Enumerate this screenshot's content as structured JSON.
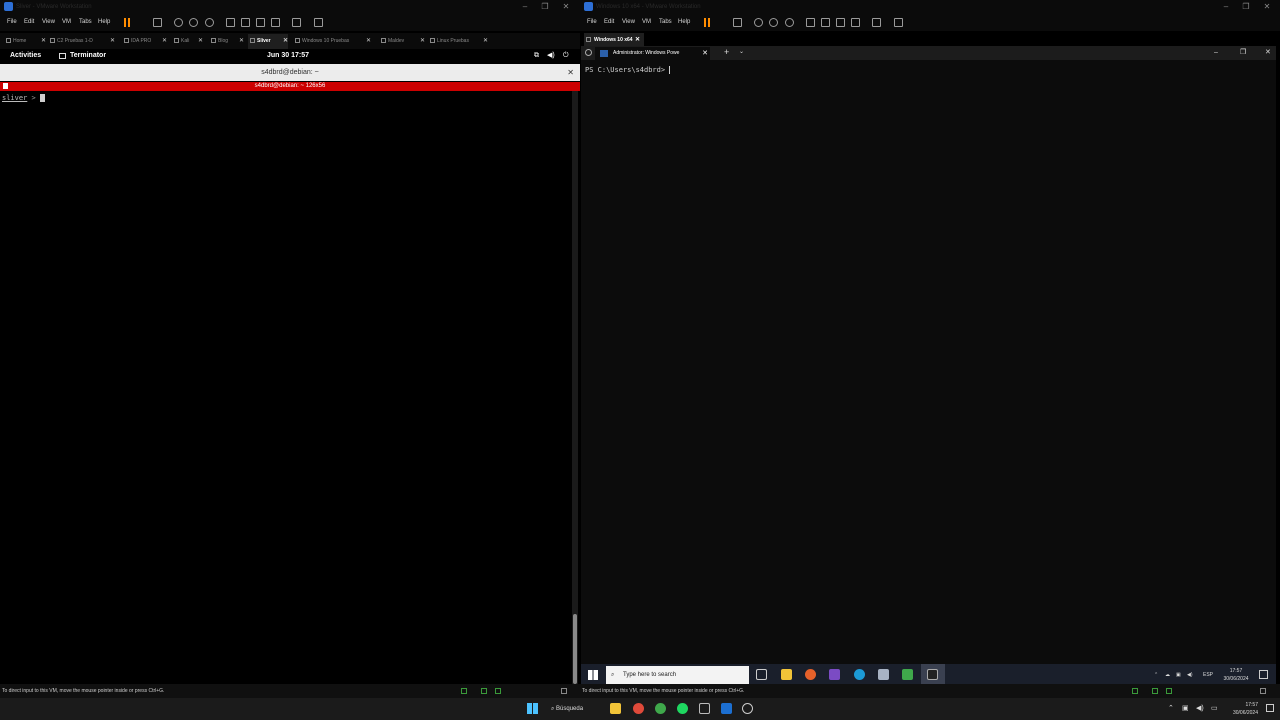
{
  "left_window": {
    "title": "Sliver - VMware Workstation",
    "menu": [
      "File",
      "Edit",
      "View",
      "VM",
      "Tabs",
      "Help"
    ],
    "tabs": [
      {
        "label": "Home",
        "active": false
      },
      {
        "label": "C2 Pruebas 1-D",
        "active": false
      },
      {
        "label": "IDA PRO",
        "active": false
      },
      {
        "label": "Kali",
        "active": false
      },
      {
        "label": "Blog",
        "active": false
      },
      {
        "label": "Sliver",
        "active": true
      },
      {
        "label": "Windows 10 Pruebas",
        "active": false
      },
      {
        "label": "Maldev",
        "active": false
      },
      {
        "label": "Linux Pruebas",
        "active": false
      }
    ],
    "gnome": {
      "activities": "Activities",
      "app": "Terminator",
      "clock": "Jun 30  17:57"
    },
    "terminal": {
      "title": "s4dbrd@debian: ~",
      "group_bar": "s4dbrd@debian: ~ 126x56",
      "prompt_word": "sliver",
      "prompt_arrow": " > "
    },
    "status": "To direct input to this VM, move the mouse pointer inside or press Ctrl+G."
  },
  "right_window": {
    "title": "Windows 10 x64 - VMware Workstation",
    "menu": [
      "File",
      "Edit",
      "View",
      "VM",
      "Tabs",
      "Help"
    ],
    "vm_tab": "Windows 10 x64",
    "ps_tab": "Administrator: Windows Powe",
    "ps_prompt": "PS C:\\Users\\s4dbrd> ",
    "taskbar": {
      "search_placeholder": "Type here to search",
      "lang": "ESP",
      "time": "17:57",
      "date": "30/06/2024"
    },
    "status": "To direct input to this VM, move the mouse pointer inside or press Ctrl+G."
  },
  "host_taskbar": {
    "search_label": "Búsqueda",
    "time": "17:57",
    "date": "30/06/2024"
  },
  "colors": {
    "terminator_red": "#cc0000",
    "vmware_pause": "#ff8c00",
    "ps_background": "#0c0c0c"
  }
}
